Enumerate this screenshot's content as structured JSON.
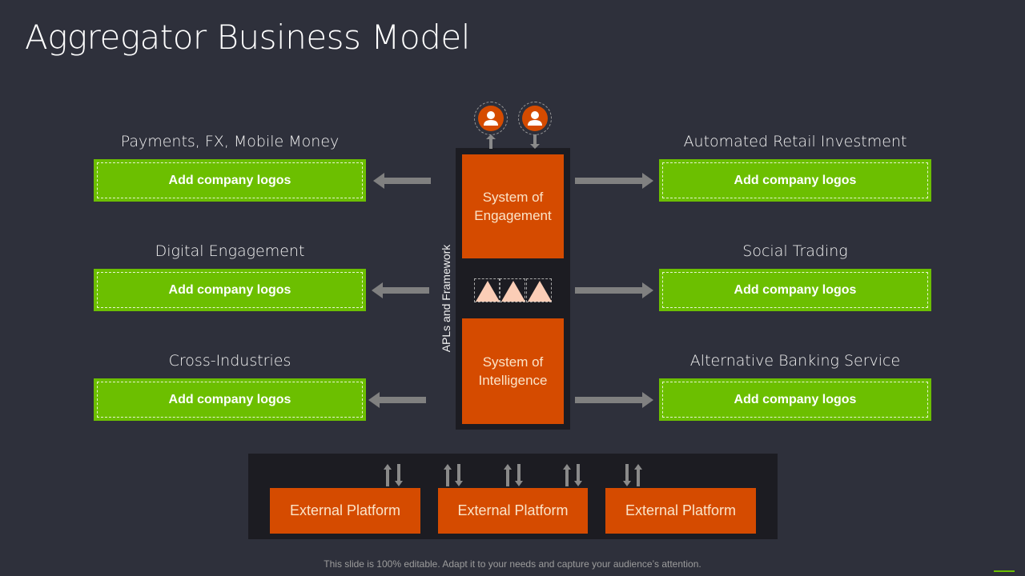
{
  "title": "Aggregator Business Model",
  "left_categories": [
    {
      "label": "Payments, FX, Mobile Money",
      "box_text": "Add company logos"
    },
    {
      "label": "Digital Engagement",
      "box_text": "Add company logos"
    },
    {
      "label": "Cross-Industries",
      "box_text": "Add company logos"
    }
  ],
  "right_categories": [
    {
      "label": "Automated Retail Investment",
      "box_text": "Add company logos"
    },
    {
      "label": "Social Trading",
      "box_text": "Add company logos"
    },
    {
      "label": "Alternative Banking Service",
      "box_text": "Add company logos"
    }
  ],
  "core": {
    "vertical_label": "APLs and Framework",
    "top_system": "System of Engagement",
    "bottom_system": "System of Intelligence",
    "users": [
      "user-icon",
      "user-icon"
    ]
  },
  "external_platforms": [
    "External Platform",
    "External Platform",
    "External Platform"
  ],
  "footer": "This slide is 100% editable. Adapt it to your needs and capture your audience’s attention.",
  "colors": {
    "background": "#2e303b",
    "green": "#6cbf00",
    "orange": "#d54b00",
    "panel": "#1c1c22",
    "arrow": "#808080"
  }
}
